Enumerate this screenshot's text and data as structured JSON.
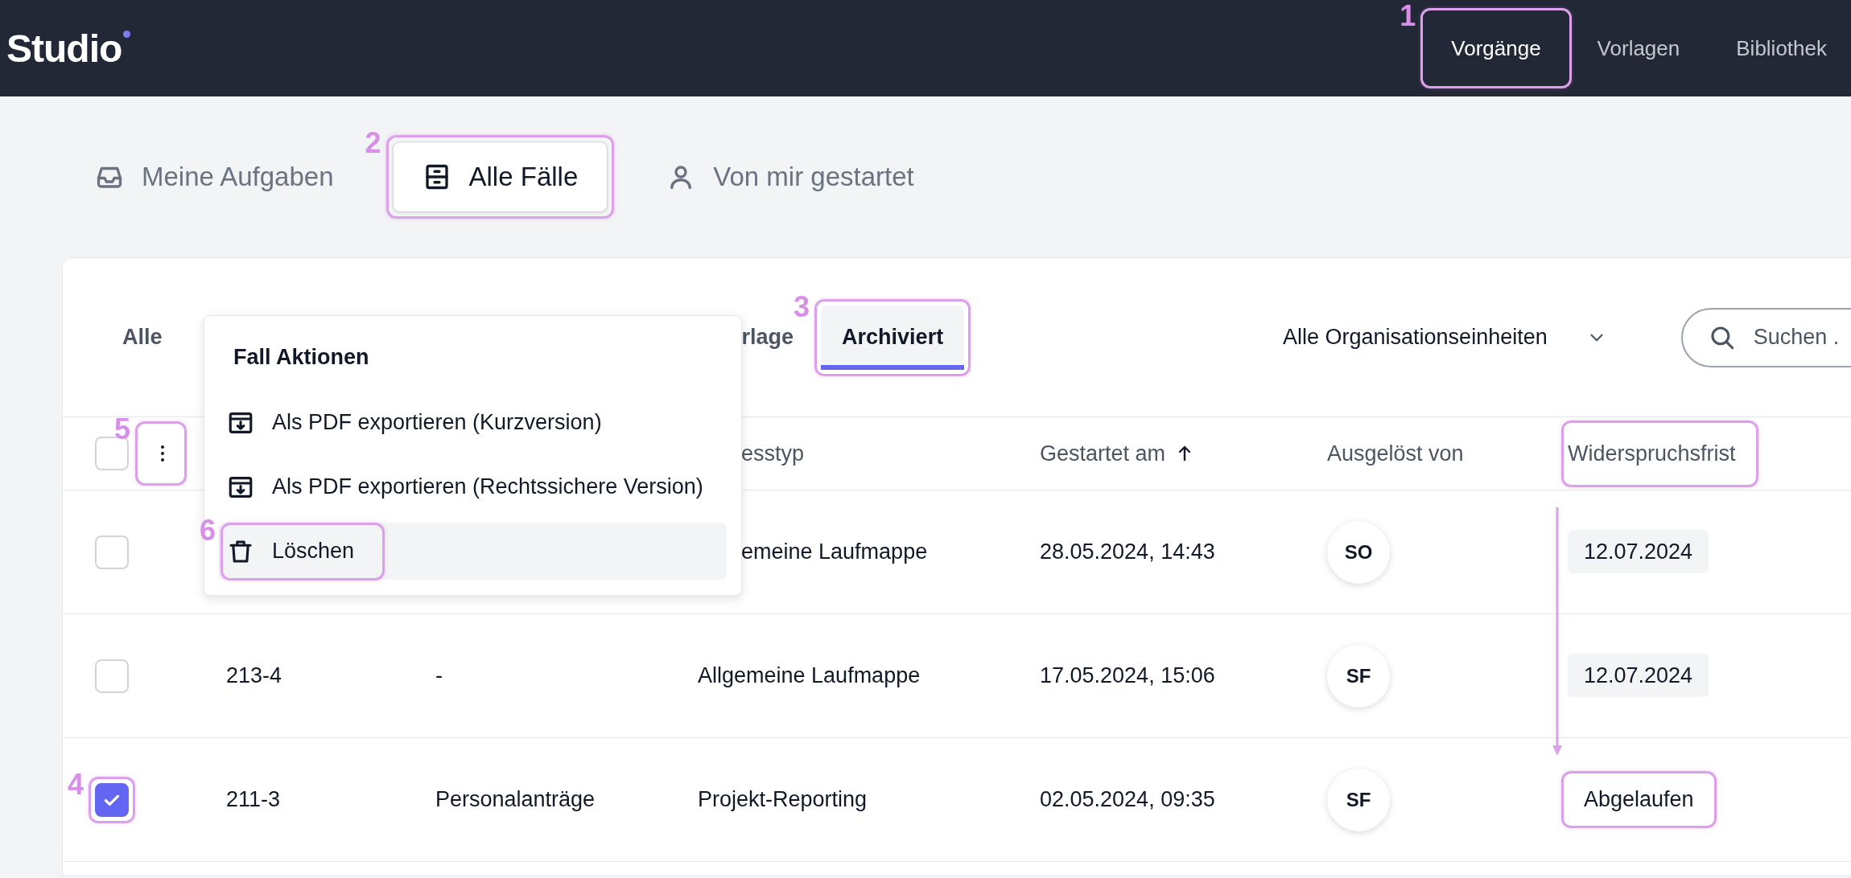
{
  "header": {
    "logo": "Studio",
    "nav": [
      {
        "label": "Vorgänge",
        "selected": true,
        "highlighted": true,
        "callout_number": "1"
      },
      {
        "label": "Vorlagen",
        "selected": false
      },
      {
        "label": "Bibliothek",
        "selected": false
      }
    ]
  },
  "views": [
    {
      "label": "Meine Aufgaben",
      "selected": false
    },
    {
      "label": "Alle Fälle",
      "selected": true,
      "highlighted": true,
      "callout_number": "2"
    },
    {
      "label": "Von mir gestartet",
      "selected": false
    }
  ],
  "filter_tabs": [
    {
      "label": "Alle",
      "selected": false
    },
    {
      "label": "rlage",
      "selected": false,
      "kind": "partial"
    },
    {
      "label": "Archiviert",
      "selected": true,
      "highlighted": true,
      "callout_number": "3"
    }
  ],
  "org_select": {
    "value": "Alle Organisationseinheiten"
  },
  "search": {
    "placeholder": "Suchen ."
  },
  "table": {
    "select_all": {
      "checked": false
    },
    "actions_button": {
      "highlighted": true,
      "callout_number": "5"
    },
    "columns": [
      {
        "label": "esstyp",
        "cut": true
      },
      {
        "label": "Gestartet am",
        "sorted": true
      },
      {
        "label": "Ausgelöst von"
      },
      {
        "label": "Widerspruchsfrist",
        "highlighted": true
      }
    ],
    "rows": [
      {
        "checked": false,
        "process_type": "emeine Laufmappe",
        "process_type_cut": true,
        "started": "28.05.2024, 14:43",
        "initiator": "SO",
        "deadline": {
          "text": "12.07.2024",
          "kind": "date"
        }
      },
      {
        "checked": false,
        "id": "213-4",
        "column_3": "-",
        "process_type": "Allgemeine Laufmappe",
        "started": "17.05.2024, 15:06",
        "initiator": "SF",
        "deadline": {
          "text": "12.07.2024",
          "kind": "date"
        }
      },
      {
        "checked": true,
        "highlighted": true,
        "callout_number": "4",
        "id": "211-3",
        "column_3": "Personalanträge",
        "process_type": "Projekt-Reporting",
        "started": "02.05.2024, 09:35",
        "initiator": "SF",
        "deadline": {
          "text": "Abgelaufen",
          "kind": "status",
          "highlighted": true
        }
      }
    ]
  },
  "menu": {
    "title": "Fall Aktionen",
    "items": [
      {
        "label": "Als PDF exportieren (Kurzversion)",
        "kind": "export",
        "hovered": false
      },
      {
        "label": "Als PDF exportieren (Rechtssichere Version)",
        "kind": "export",
        "hovered": false
      },
      {
        "label": "Löschen",
        "kind": "delete",
        "hovered": true,
        "highlighted": true,
        "callout_number": "6"
      }
    ]
  }
}
